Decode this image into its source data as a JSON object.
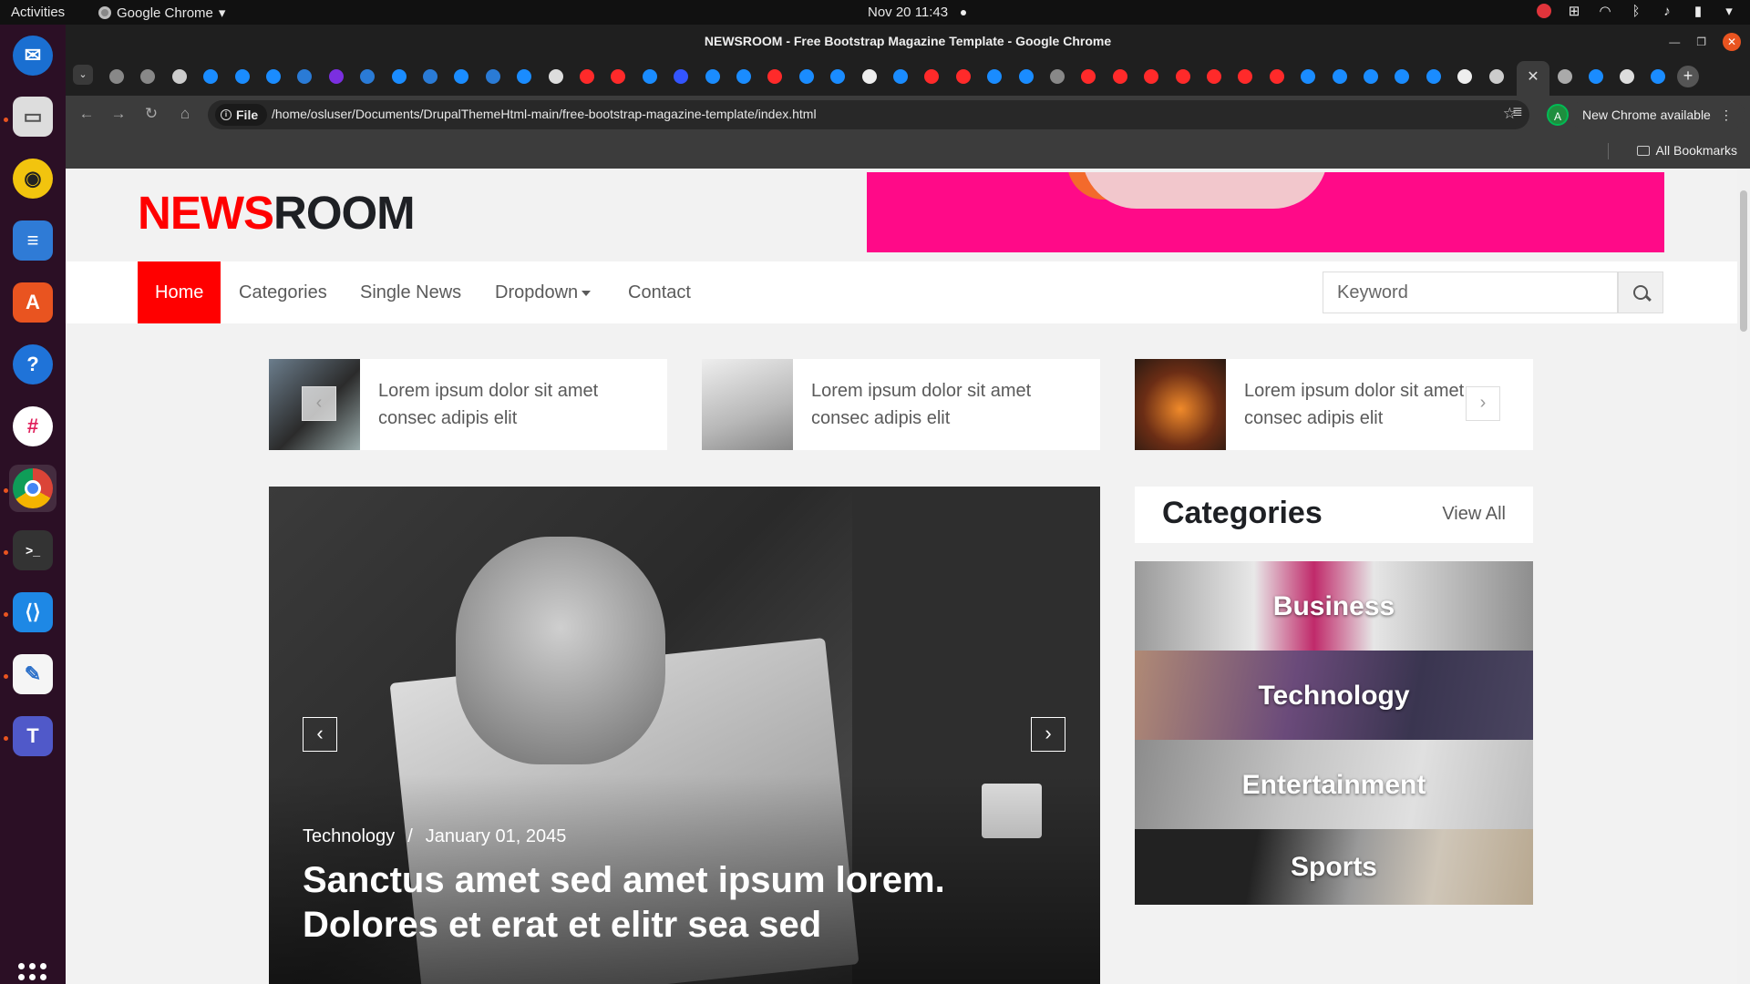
{
  "os": {
    "activities": "Activities",
    "app_name": "Google Chrome",
    "clock": "Nov 20  11:43"
  },
  "browser": {
    "window_title": "NEWSROOM - Free Bootstrap Magazine Template - Google Chrome",
    "address_prefix": "File",
    "url": "/home/osluser/Documents/DrupalThemeHtml-main/free-bootstrap-magazine-template/index.html",
    "avatar_letter": "A",
    "update_text": "New Chrome available",
    "bookmarks_label": "All Bookmarks"
  },
  "site": {
    "logo_part1": "NEWS",
    "logo_part2": "ROOM",
    "nav": {
      "home": "Home",
      "categories": "Categories",
      "single_news": "Single News",
      "dropdown": "Dropdown",
      "contact": "Contact"
    },
    "search_placeholder": "Keyword",
    "ticker": [
      {
        "text": "Lorem ipsum dolor sit amet consec adipis elit"
      },
      {
        "text": "Lorem ipsum dolor sit amet consec adipis elit"
      },
      {
        "text": "Lorem ipsum dolor sit amet consec adipis elit"
      }
    ],
    "hero": {
      "category": "Technology",
      "separator": "/",
      "date": "January 01, 2045",
      "title": "Sanctus amet sed amet ipsum lorem. Dolores et erat et elitr sea sed"
    },
    "categories_widget": {
      "title": "Categories",
      "view_all": "View All",
      "items": [
        "Business",
        "Technology",
        "Entertainment",
        "Sports"
      ]
    }
  },
  "colors": {
    "brand_red": "#ff0000",
    "dark_text": "#1e2024",
    "ad_pink": "#ff0a88",
    "dock_bg": "#2b0f25"
  }
}
